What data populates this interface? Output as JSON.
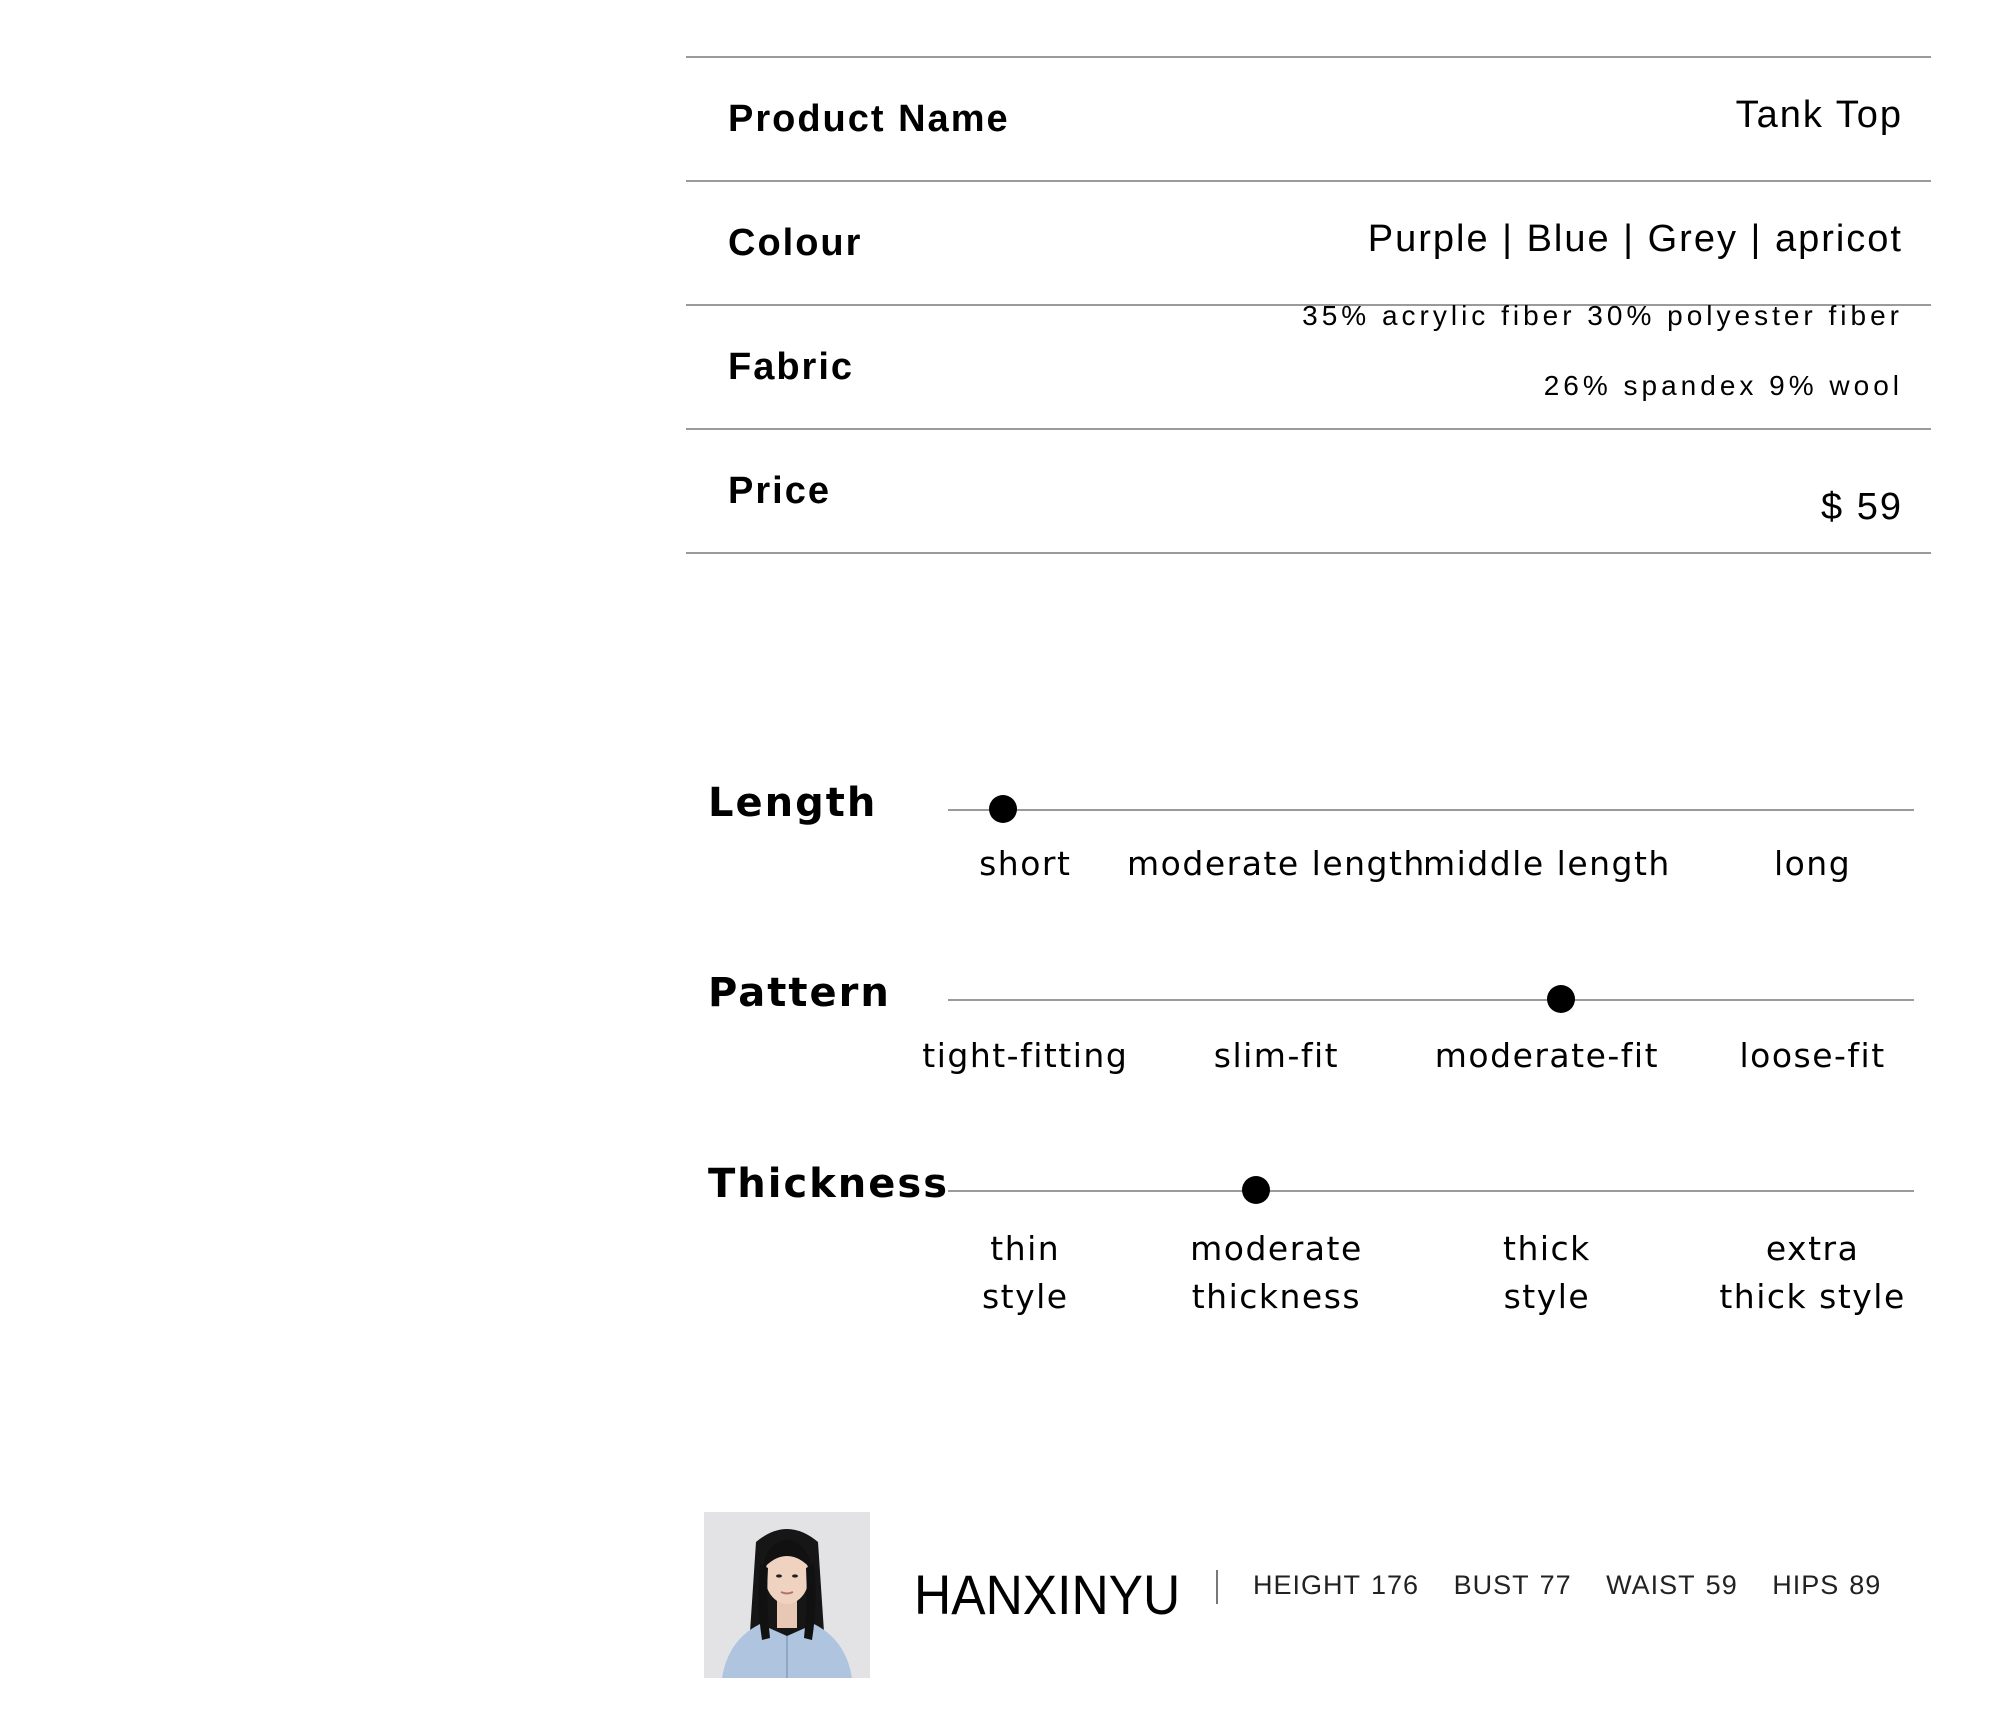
{
  "spec": {
    "product_name": {
      "label": "Product Name",
      "value": "Tank Top"
    },
    "colour": {
      "label": "Colour",
      "value": "Purple | Blue | Grey | apricot"
    },
    "fabric": {
      "label": "Fabric",
      "line1": "35% acrylic fiber 30% polyester fiber",
      "line2": "26% spandex 9% wool"
    },
    "price": {
      "label": "Price",
      "value": "$ 59"
    }
  },
  "scales": {
    "length": {
      "label": "Length",
      "options": [
        "short",
        "moderate length",
        "middle length",
        "long"
      ],
      "selected_fraction": 0.057
    },
    "pattern": {
      "label": "Pattern",
      "options": [
        "tight-fitting",
        "slim-fit",
        "moderate-fit",
        "loose-fit"
      ],
      "selected_fraction": 0.635
    },
    "thickness": {
      "label": "Thickness",
      "options": [
        [
          "thin",
          "style"
        ],
        [
          "moderate",
          "thickness"
        ],
        [
          "thick",
          "style"
        ],
        [
          "extra",
          "thick style"
        ]
      ],
      "selected_fraction": 0.319
    }
  },
  "model": {
    "name": "HANXINYU",
    "stats": [
      {
        "key": "HEIGHT",
        "value": "176"
      },
      {
        "key": "BUST",
        "value": "77"
      },
      {
        "key": "WAIST",
        "value": "59"
      },
      {
        "key": "HIPS",
        "value": "89"
      }
    ]
  }
}
